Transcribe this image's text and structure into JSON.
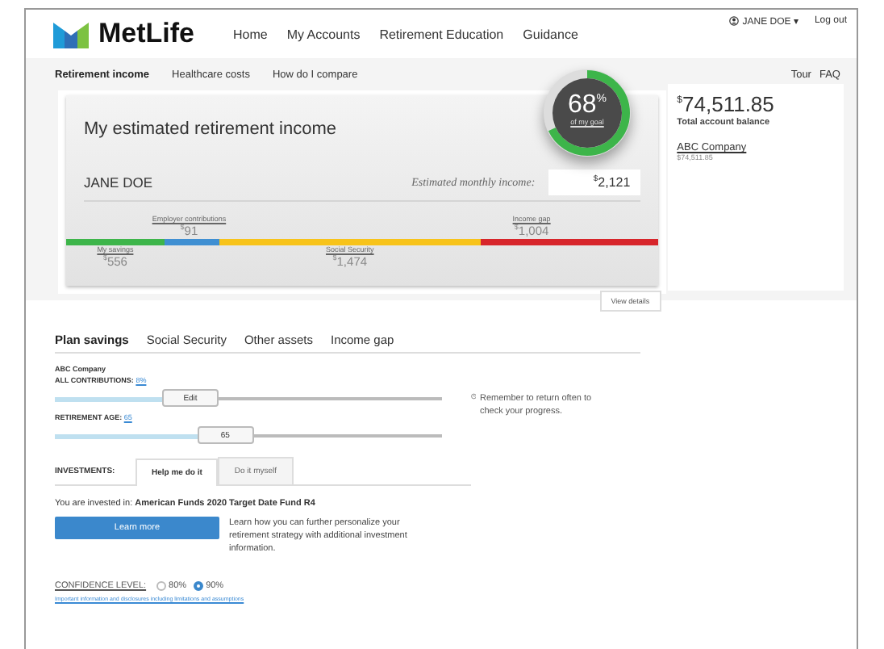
{
  "header": {
    "logo": "MetLife",
    "nav": [
      "Home",
      "My Accounts",
      "Retirement Education",
      "Guidance"
    ],
    "user": "JANE DOE",
    "user_caret": "▾",
    "logout": "Log out"
  },
  "subnav": {
    "tabs": [
      {
        "label": "Retirement income",
        "selected": true
      },
      {
        "label": "Healthcare costs",
        "selected": false
      },
      {
        "label": "How do I compare",
        "selected": false
      }
    ],
    "links": [
      "Tour",
      "FAQ"
    ]
  },
  "goal": {
    "percent": "68",
    "unit": "%",
    "caption": "of my goal"
  },
  "income_card": {
    "title": "My estimated retirement income",
    "name": "JANE DOE",
    "monthly_label": "Estimated monthly income:",
    "monthly_currency": "$",
    "monthly_value": "2,121",
    "segments": [
      {
        "label": "My savings",
        "currency": "$",
        "value": "556",
        "color": "#3db54a",
        "kind": "below"
      },
      {
        "label": "Employer contributions",
        "currency": "$",
        "value": "91",
        "color": "#3f8fd2",
        "kind": "above"
      },
      {
        "label": "Social Security",
        "currency": "$",
        "value": "1,474",
        "color": "#f7c31a",
        "kind": "below"
      },
      {
        "label": "Income gap",
        "currency": "$",
        "value": "1,004",
        "color": "#d7252b",
        "kind": "above"
      }
    ],
    "details_button": "View details"
  },
  "account": {
    "currency": "$",
    "balance": "74,511.85",
    "balance_label": "Total account balance",
    "company": "ABC Company",
    "company_balance": "$74,511.85"
  },
  "plan_tabs": [
    {
      "label": "Plan savings",
      "selected": true
    },
    {
      "label": "Social Security",
      "selected": false
    },
    {
      "label": "Other assets",
      "selected": false
    },
    {
      "label": "Income gap",
      "selected": false
    }
  ],
  "plan": {
    "company": "ABC Company",
    "contributions_label": "ALL CONTRIBUTIONS:",
    "contributions_value": "8%",
    "contributions_slider": {
      "thumb": "Edit",
      "level": 0.35
    },
    "age_label": "RETIREMENT AGE:",
    "age_value": "65",
    "age_slider": {
      "thumb": "65",
      "level": 0.44
    },
    "reminder": "Remember to return often to check your progress."
  },
  "investments": {
    "label": "INVESTMENTS:",
    "tabs": [
      {
        "label": "Help me do it",
        "selected": true
      },
      {
        "label": "Do it myself",
        "selected": false
      }
    ],
    "invested": "You are invested in: **American Funds 2020 Target Date Fund R4**",
    "learn_more": "Learn more",
    "description": "Learn how you can further personalize your retirement strategy with additional investment information."
  },
  "confidence": {
    "label": "CONFIDENCE LEVEL:",
    "options": [
      {
        "label": "80%",
        "selected": false
      },
      {
        "label": "90%",
        "selected": true
      }
    ]
  },
  "disclaimer": "Important information and disclosures including limitations and assumptions"
}
